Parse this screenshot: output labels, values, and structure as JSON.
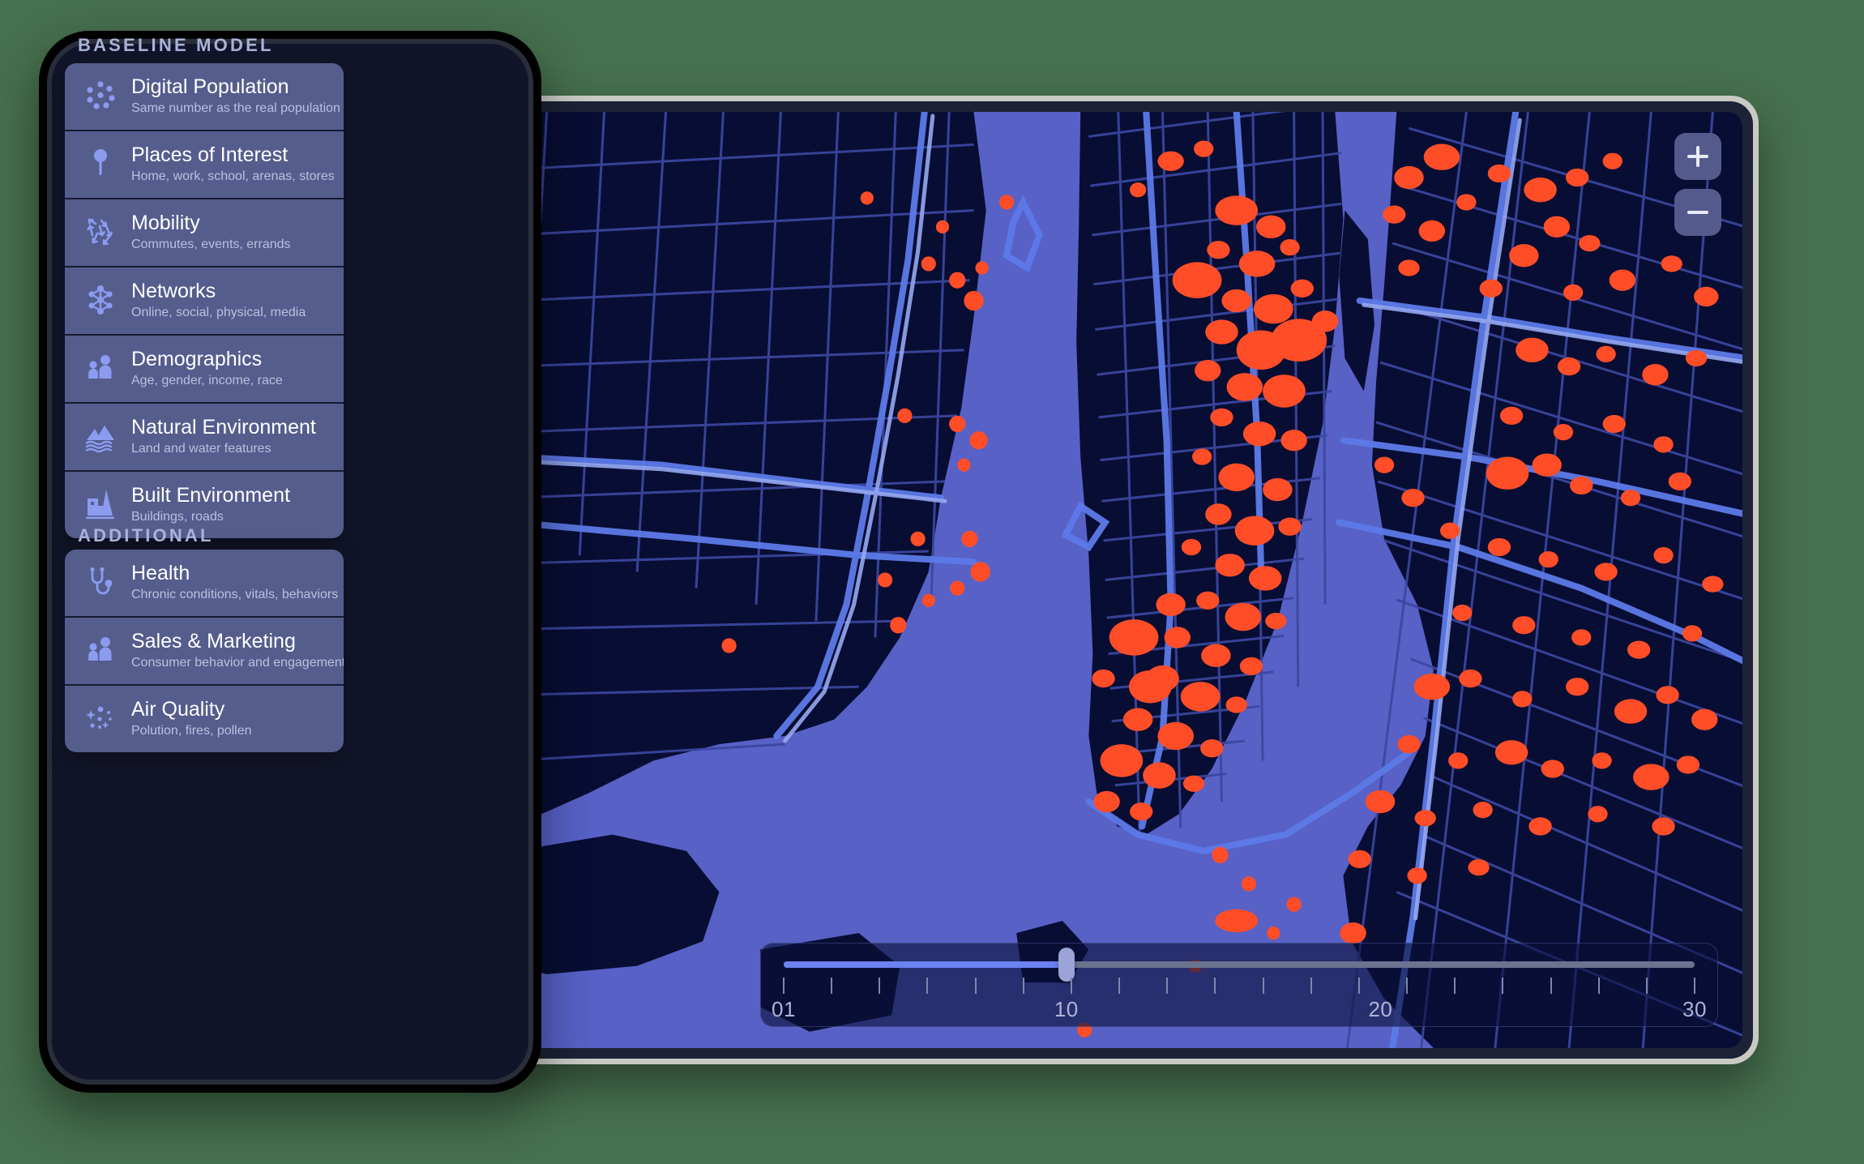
{
  "theme": {
    "background": "#47704e",
    "panel_row_bg": "#555d8d",
    "icon_color": "#8b9cf0",
    "map_land": "#080d33",
    "map_water": "#5761c6",
    "map_roads": "#3b47a0",
    "map_highlight": "#5d7ae8",
    "data_point": "#ff4d28",
    "accent_blue": "#6b82f0"
  },
  "sections": [
    {
      "header": "BASELINE MODEL",
      "items": [
        {
          "icon": "dot-cluster-icon",
          "title": "Digital Population",
          "subtitle": "Same number as the real population"
        },
        {
          "icon": "map-pin-icon",
          "title": "Places of Interest",
          "subtitle": "Home, work, school, arenas, stores"
        },
        {
          "icon": "arrows-scatter-icon",
          "title": "Mobility",
          "subtitle": "Commutes, events, errands"
        },
        {
          "icon": "network-nodes-icon",
          "title": "Networks",
          "subtitle": "Online, social, physical, media"
        },
        {
          "icon": "two-people-icon",
          "title": "Demographics",
          "subtitle": "Age, gender, income, race"
        },
        {
          "icon": "mountains-water-icon",
          "title": "Natural Environment",
          "subtitle": "Land and water features"
        },
        {
          "icon": "buildings-icon",
          "title": "Built Environment",
          "subtitle": "Buildings, roads"
        }
      ]
    },
    {
      "header": "ADDITIONAL",
      "items": [
        {
          "icon": "stethoscope-icon",
          "title": "Health",
          "subtitle": "Chronic conditions, vitals, behaviors"
        },
        {
          "icon": "two-people-icon",
          "title": "Sales & Marketing",
          "subtitle": "Consumer behavior and engagement"
        },
        {
          "icon": "sparkle-particles-icon",
          "title": "Air Quality",
          "subtitle": "Polution, fires, pollen"
        }
      ]
    }
  ],
  "map": {
    "zoom_in_label": "+",
    "zoom_out_label": "−"
  },
  "timeline": {
    "min": 1,
    "max": 30,
    "value": 10,
    "tick_count": 20,
    "labels": [
      {
        "text": "01",
        "position": 1
      },
      {
        "text": "10",
        "position": 10
      },
      {
        "text": "20",
        "position": 20
      },
      {
        "text": "30",
        "position": 30
      }
    ]
  }
}
